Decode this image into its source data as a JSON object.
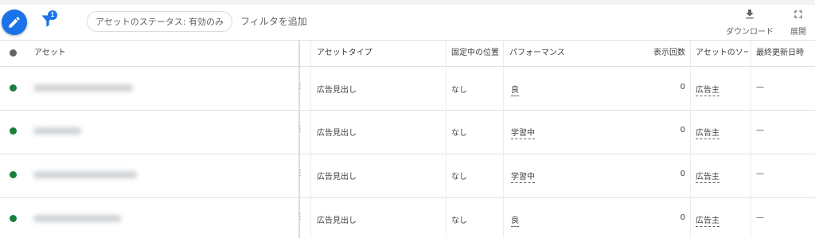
{
  "toolbar": {
    "filter_badge": "1",
    "status_chip": "アセットのステータス: 有効のみ",
    "add_filter": "フィルタを追加",
    "download_label": "ダウンロード",
    "expand_label": "展開"
  },
  "columns": {
    "asset": "アセット",
    "asset_type": "アセットタイプ",
    "pinned_position": "固定中の位置",
    "performance": "パフォーマンス",
    "impressions": "表示回数",
    "asset_source": "アセットのソー",
    "last_updated": "最終更新日時"
  },
  "rows": [
    {
      "asset_type": "広告見出し",
      "pinned": "なし",
      "performance": "良",
      "impressions": "0",
      "source": "広告主",
      "updated": "—"
    },
    {
      "asset_type": "広告見出し",
      "pinned": "なし",
      "performance": "学習中",
      "impressions": "0",
      "source": "広告主",
      "updated": "—"
    },
    {
      "asset_type": "広告見出し",
      "pinned": "なし",
      "performance": "学習中",
      "impressions": "0",
      "source": "広告主",
      "updated": "—"
    },
    {
      "asset_type": "広告見出し",
      "pinned": "なし",
      "performance": "良",
      "impressions": "0",
      "source": "広告主",
      "updated": "—"
    }
  ],
  "colors": {
    "accent": "#1a73e8",
    "status_enabled": "#188038"
  },
  "icons": [
    "pencil-icon",
    "filter-icon",
    "download-icon",
    "fullscreen-icon"
  ]
}
